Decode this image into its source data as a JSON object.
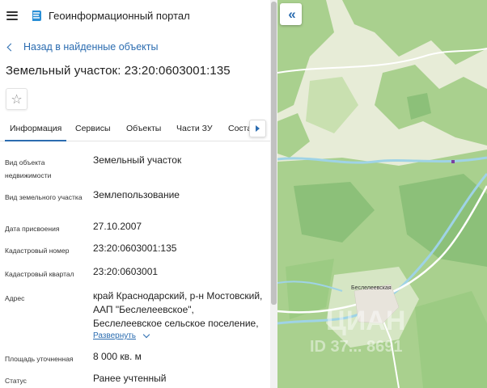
{
  "header": {
    "app_title": "Геоинформационный портал",
    "logo": "globe-wave-icon"
  },
  "back_link": {
    "label": "Назад в найденные объекты"
  },
  "object": {
    "title": "Земельный участок: 23:20:0603001:135"
  },
  "tabs": [
    {
      "label": "Информация",
      "active": true
    },
    {
      "label": "Сервисы"
    },
    {
      "label": "Объекты"
    },
    {
      "label": "Части ЗУ"
    },
    {
      "label": "Соста"
    }
  ],
  "fields": [
    {
      "key": "Вид объекта недвижимости",
      "value": "Земельный участок"
    },
    {
      "key": "Вид земельного участка",
      "value": "Землепользование"
    },
    {
      "key": "Дата присвоения",
      "value": "27.10.2007"
    },
    {
      "key": "Кадастровый номер",
      "value": "23:20:0603001:135"
    },
    {
      "key": "Кадастровый квартал",
      "value": "23:20:0603001"
    },
    {
      "key": "Адрес",
      "value": "край Краснодарский, р-н Мостовский, ААП \"Беслелеевское\", Беслелеевское сельское поселение,"
    },
    {
      "key": "Площадь уточненная",
      "value": "8 000 кв. м"
    },
    {
      "key": "Статус",
      "value": "Ранее учтенный"
    }
  ],
  "expand_label": "Развернуть",
  "map": {
    "collapse_icon": "double-chevron-left-icon",
    "town_label": "Беслелеевская",
    "watermark": "ЦИАН",
    "watermark_id": "ID 37... 8691",
    "colors": {
      "forest": "#a9d08e",
      "dark_forest": "#8cc079",
      "meadow": "#e7ecd7",
      "river": "#9fd3e6",
      "road": "#ffffff"
    }
  }
}
